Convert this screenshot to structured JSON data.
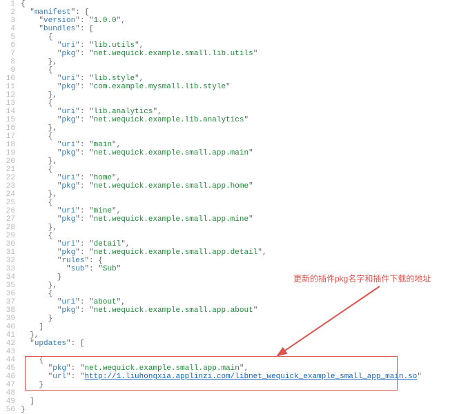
{
  "line_count": 50,
  "comment_text": "更新的插件pkg名字和插件下载的地址",
  "code_lines": [
    {
      "ind": 0,
      "raw": "{"
    },
    {
      "ind": 1,
      "raw": "\"manifest\": {",
      "key": "manifest"
    },
    {
      "ind": 2,
      "raw": "\"version\": \"1.0.0\",",
      "key": "version",
      "val": "1.0.0"
    },
    {
      "ind": 2,
      "raw": "\"bundles\": [",
      "key": "bundles"
    },
    {
      "ind": 3,
      "raw": "{"
    },
    {
      "ind": 4,
      "raw": "\"uri\": \"lib.utils\",",
      "key": "uri",
      "val": "lib.utils"
    },
    {
      "ind": 4,
      "raw": "\"pkg\": \"net.wequick.example.small.lib.utils\"",
      "key": "pkg",
      "val": "net.wequick.example.small.lib.utils"
    },
    {
      "ind": 3,
      "raw": "},"
    },
    {
      "ind": 3,
      "raw": "{"
    },
    {
      "ind": 4,
      "raw": "\"uri\": \"lib.style\",",
      "key": "uri",
      "val": "lib.style"
    },
    {
      "ind": 4,
      "raw": "\"pkg\": \"com.example.mysmall.lib.style\"",
      "key": "pkg",
      "val": "com.example.mysmall.lib.style"
    },
    {
      "ind": 3,
      "raw": "},"
    },
    {
      "ind": 3,
      "raw": "{"
    },
    {
      "ind": 4,
      "raw": "\"uri\": \"lib.analytics\",",
      "key": "uri",
      "val": "lib.analytics"
    },
    {
      "ind": 4,
      "raw": "\"pkg\": \"net.wequick.example.lib.analytics\"",
      "key": "pkg",
      "val": "net.wequick.example.lib.analytics"
    },
    {
      "ind": 3,
      "raw": "},"
    },
    {
      "ind": 3,
      "raw": "{"
    },
    {
      "ind": 4,
      "raw": "\"uri\": \"main\",",
      "key": "uri",
      "val": "main"
    },
    {
      "ind": 4,
      "raw": "\"pkg\": \"net.wequick.example.small.app.main\"",
      "key": "pkg",
      "val": "net.wequick.example.small.app.main"
    },
    {
      "ind": 3,
      "raw": "},"
    },
    {
      "ind": 3,
      "raw": "{"
    },
    {
      "ind": 4,
      "raw": "\"uri\": \"home\",",
      "key": "uri",
      "val": "home"
    },
    {
      "ind": 4,
      "raw": "\"pkg\": \"net.wequick.example.small.app.home\"",
      "key": "pkg",
      "val": "net.wequick.example.small.app.home"
    },
    {
      "ind": 3,
      "raw": "},"
    },
    {
      "ind": 3,
      "raw": "{"
    },
    {
      "ind": 4,
      "raw": "\"uri\": \"mine\",",
      "key": "uri",
      "val": "mine"
    },
    {
      "ind": 4,
      "raw": "\"pkg\": \"net.wequick.example.small.app.mine\"",
      "key": "pkg",
      "val": "net.wequick.example.small.app.mine"
    },
    {
      "ind": 3,
      "raw": "},"
    },
    {
      "ind": 3,
      "raw": "{"
    },
    {
      "ind": 4,
      "raw": "\"uri\": \"detail\",",
      "key": "uri",
      "val": "detail"
    },
    {
      "ind": 4,
      "raw": "\"pkg\": \"net.wequick.example.small.app.detail\",",
      "key": "pkg",
      "val": "net.wequick.example.small.app.detail"
    },
    {
      "ind": 4,
      "raw": "\"rules\": {",
      "key": "rules"
    },
    {
      "ind": 5,
      "raw": "\"sub\": \"Sub\"",
      "key": "sub",
      "val": "Sub"
    },
    {
      "ind": 4,
      "raw": "}"
    },
    {
      "ind": 3,
      "raw": "},"
    },
    {
      "ind": 3,
      "raw": "{"
    },
    {
      "ind": 4,
      "raw": "\"uri\": \"about\",",
      "key": "uri",
      "val": "about"
    },
    {
      "ind": 4,
      "raw": "\"pkg\": \"net.wequick.example.small.app.about\"",
      "key": "pkg",
      "val": "net.wequick.example.small.app.about"
    },
    {
      "ind": 3,
      "raw": "}"
    },
    {
      "ind": 2,
      "raw": "]"
    },
    {
      "ind": 1,
      "raw": "},"
    },
    {
      "ind": 1,
      "raw": "\"updates\": [",
      "key": "updates"
    },
    {
      "ind": 0,
      "raw": ""
    },
    {
      "ind": 2,
      "raw": "{"
    },
    {
      "ind": 3,
      "raw": "\"pkg\": \"net.wequick.example.small.app.main\",",
      "key": "pkg",
      "val": "net.wequick.example.small.app.main"
    },
    {
      "ind": 3,
      "raw": "\"url\": \"http://1.liuhongxia.applinzi.com/libnet_wequick_example_small_app_main.so\"",
      "key": "url",
      "val": "http://1.liuhongxia.applinzi.com/libnet_wequick_example_small_app_main.so",
      "is_url": true
    },
    {
      "ind": 2,
      "raw": "}"
    },
    {
      "ind": 0,
      "raw": ""
    },
    {
      "ind": 1,
      "raw": "]"
    },
    {
      "ind": 0,
      "raw": "}"
    }
  ]
}
